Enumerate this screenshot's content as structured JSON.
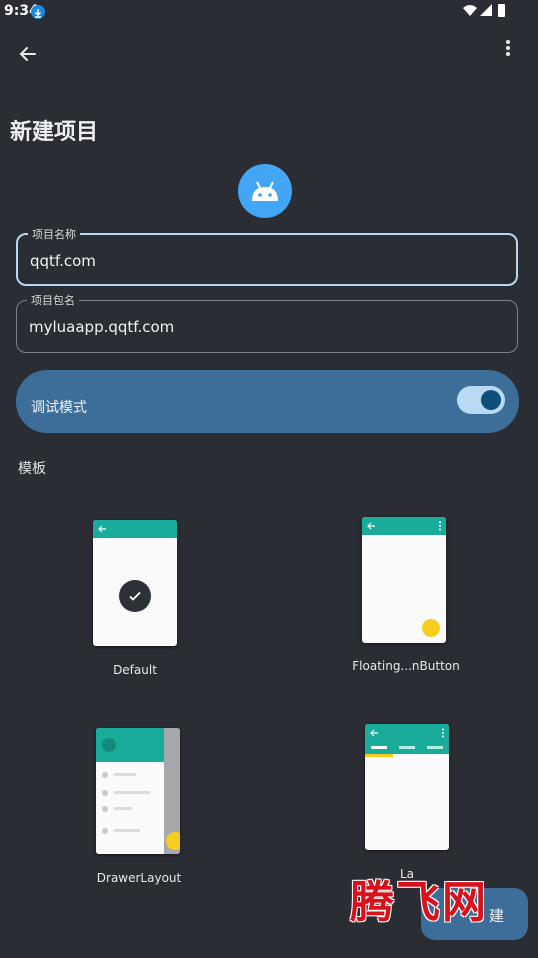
{
  "status_bar": {
    "time": "9:34"
  },
  "page": {
    "title": "新建项目"
  },
  "fields": {
    "project_name": {
      "label": "项目名称",
      "value": "qqtf.com"
    },
    "package_name": {
      "label": "项目包名",
      "value": "myluaapp.qqtf.com"
    }
  },
  "debug_mode": {
    "label": "调试模式",
    "enabled": true
  },
  "templates": {
    "section_label": "模板",
    "items": [
      {
        "label": "Default",
        "selected": true
      },
      {
        "label": "Floating...nButton",
        "selected": false
      },
      {
        "label": "DrawerLayout",
        "selected": false
      },
      {
        "label": "La",
        "selected": false
      }
    ]
  },
  "create_button": {
    "label": "建"
  },
  "watermark": {
    "text": "腾飞网"
  },
  "colors": {
    "background": "#2a2d33",
    "accent": "#3d6e99",
    "template_bar": "#1aac9a",
    "fab": "#f6cc1e",
    "app_icon": "#42a5f5"
  }
}
